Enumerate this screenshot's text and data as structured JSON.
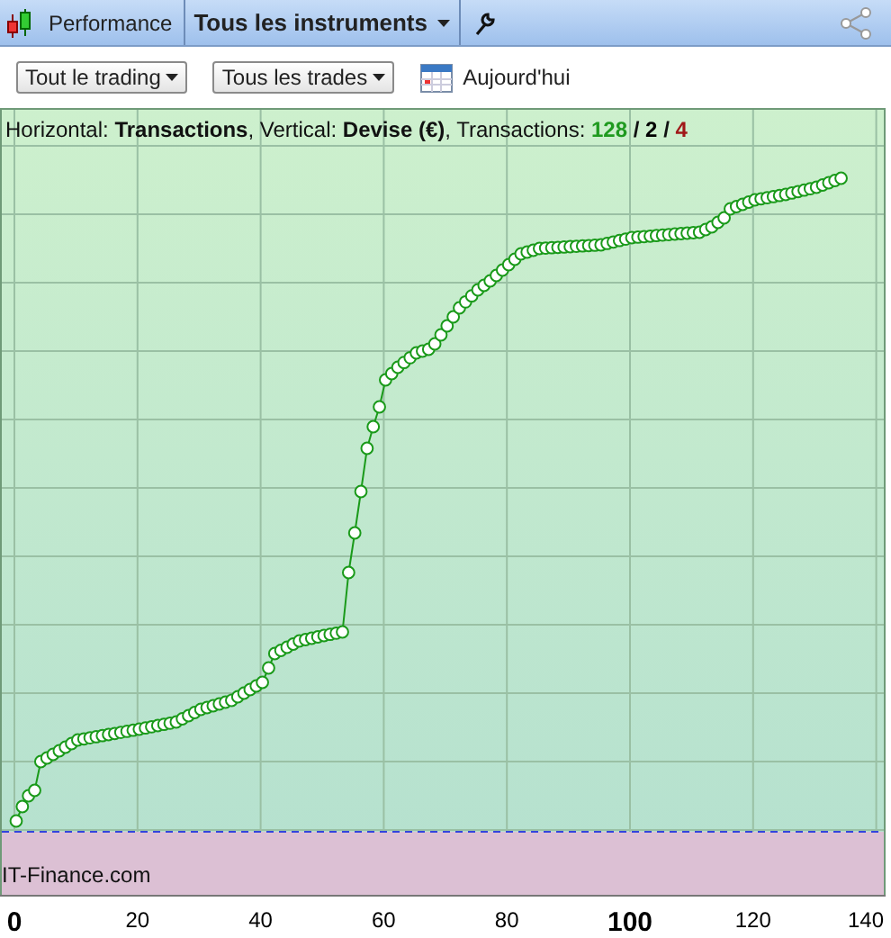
{
  "toolbar": {
    "title": "Performance",
    "instrument_menu": "Tous les instruments"
  },
  "filters": [
    {
      "label": "Tout le trading"
    },
    {
      "label": "Tous les trades"
    }
  ],
  "date": {
    "label": "Aujourd'hui"
  },
  "chart": {
    "info": "Horizontal: **Transactions**, Vertical: **Devise (€)**, Transactions: ",
    "separator": "/",
    "counts": [
      {
        "value": "128",
        "color": "#1f9a1f"
      },
      {
        "value": "2",
        "color": "#000000"
      },
      {
        "value": "4",
        "color": "#a01818"
      }
    ],
    "watermark": "IT-Finance.com",
    "x_ticks": [
      {
        "label": "0",
        "major": true
      },
      {
        "label": "20",
        "major": false
      },
      {
        "label": "40",
        "major": false
      },
      {
        "label": "60",
        "major": false
      },
      {
        "label": "80",
        "major": false
      },
      {
        "label": "100",
        "major": true
      },
      {
        "label": "120",
        "major": false
      },
      {
        "label": "140",
        "major": false
      }
    ]
  }
}
